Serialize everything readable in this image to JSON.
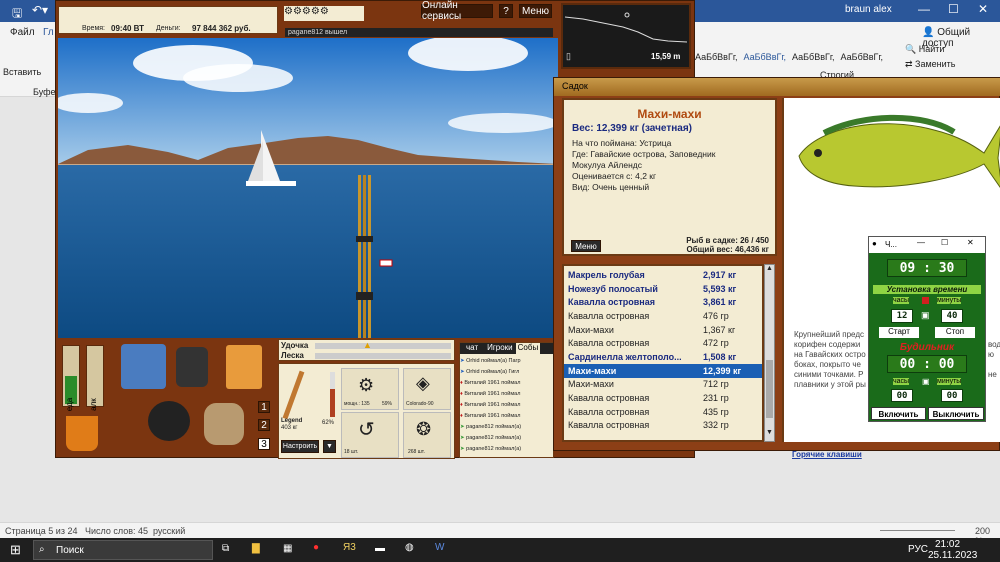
{
  "word": {
    "user": "braun alex",
    "share": "Общий доступ",
    "tab_file": "Файл",
    "tab_home_partial": "Гл",
    "paste": "Вставить",
    "clipboard": "Буфер",
    "styles": [
      "АаБбВвГг,",
      "АаБбВвГг,",
      "АаБбВвГг,",
      "АаБбВвГг,"
    ],
    "style_names": [
      "",
      "",
      "Строгий",
      ""
    ],
    "find": "Найти",
    "replace": "Заменить",
    "page_info": "Страница 5 из 24",
    "words": "Число слов: 45",
    "lang": "русский",
    "zoom": "200 %"
  },
  "taskbar": {
    "search": "Поиск",
    "lang": "РУС",
    "time": "21:02",
    "date": "25.11.2023"
  },
  "game": {
    "time_label": "Время:",
    "time": "09:40 ВТ",
    "money_label": "Деньги:",
    "money": "97 844 362 руб.",
    "online": "Онлайн сервисы",
    "help": "?",
    "menu": "Меню",
    "chat_msg": "pagane812 вышел",
    "depth": "15,59 m",
    "rod": "Удочка",
    "line": "Леска",
    "eda": "еда",
    "alk": "алк",
    "slots": [
      "1",
      "2",
      "3"
    ],
    "tackle": {
      "rod_name": "Legend",
      "rod_weight": "403 кг",
      "rod_pct": "62%",
      "reel_name": "мощн.: 135",
      "reel_pct": "59%",
      "lure": "Colorado-90",
      "hooks": "18 шт.",
      "bait": "268 шт.",
      "setup": "Настроить",
      "arrow": "▼"
    },
    "tabs": [
      "чат",
      "Игроки",
      "Собы"
    ],
    "events": [
      "Orhid поймал(а) Пагр",
      "Orhid поймал(а) Гигл",
      "Виталий 1961 поймал",
      "Виталий 1961 поймал",
      "Виталий 1961 поймал",
      "Виталий 1961 поймал",
      "pagane812 поймал(а)",
      "pagane812 поймал(а)",
      "pagane812 поймал(а)"
    ]
  },
  "sadok": {
    "title": "Садок",
    "fish_name": "Махи-махи",
    "weight": "Вес: 12,399 кг (зачетная)",
    "bait": "На что поймана: Устрица",
    "where1": "Где: Гавайские острова, Заповедник",
    "where2": "Мокулуа Айлендс",
    "value": "Оценивается с: 4,2 кг",
    "kind": "Вид: Очень ценный",
    "menu": "Меню",
    "count": "Рыб в садке: 26 / 450",
    "total": "Общий вес: 46,436 кг",
    "fish_list": [
      {
        "name": "Макрель голубая",
        "weight": "2,917 кг",
        "bold": true
      },
      {
        "name": "Ножезуб полосатый",
        "weight": "5,593 кг",
        "bold": true
      },
      {
        "name": "Кавалла островная",
        "weight": "3,861 кг",
        "bold": true
      },
      {
        "name": "Кавалла островная",
        "weight": "476 гр",
        "bold": false
      },
      {
        "name": "Махи-махи",
        "weight": "1,367 кг",
        "bold": false
      },
      {
        "name": "Кавалла островная",
        "weight": "472 гр",
        "bold": false
      },
      {
        "name": "Сардинелла желтополо...",
        "weight": "1,508 кг",
        "bold": true
      },
      {
        "name": "Махи-махи",
        "weight": "12,399 кг",
        "bold": true,
        "selected": true
      },
      {
        "name": "Махи-махи",
        "weight": "712 гр",
        "bold": false
      },
      {
        "name": "Кавалла островная",
        "weight": "231 гр",
        "bold": false
      },
      {
        "name": "Кавалла островная",
        "weight": "435 гр",
        "bold": false
      },
      {
        "name": "Кавалла островная",
        "weight": "332 гр",
        "bold": false
      }
    ],
    "desc1": "Крупнейший предс",
    "desc2": "корифен содержи",
    "desc3": "на Гавайских остро",
    "desc4": "боках, покрыто че",
    "desc5": "синими точками. Р",
    "desc6": "плавники у этой ры",
    "side1": "вод",
    "side2": "ю",
    "side3": "не",
    "hotkeys": "Горячие клавиши"
  },
  "alarm": {
    "title": "Ч...",
    "clock": "09 : 30",
    "set_label": "Установка времени",
    "hours": "часы",
    "minutes": "минуты",
    "h": "12",
    "m": "40",
    "start": "Старт",
    "stop": "Стоп",
    "alarm_label": "Будильник",
    "alarm_time": "00 : 00",
    "ah": "00",
    "am": "00",
    "on": "Включить",
    "off": "Выключить"
  }
}
